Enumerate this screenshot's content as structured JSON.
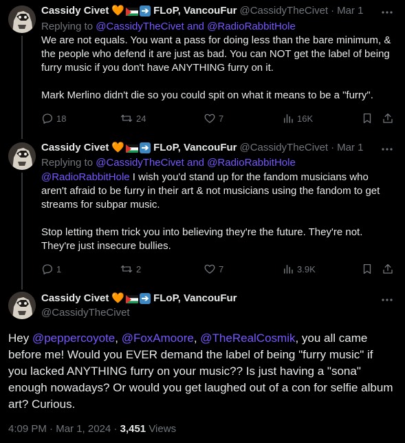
{
  "tweets": [
    {
      "name": "Cassidy Civet",
      "emoji": "🧡",
      "location": "FLoP, VancouFur",
      "handle": "@CassidyTheCivet",
      "dot": "·",
      "date": "Mar 1",
      "replying_prefix": "Replying to",
      "replying_to": "@CassidyTheCivet and @RadioRabbitHole",
      "paragraphs": [
        "We are not equals. You want a pass for doing less than the bare minimum, & the people who defend it are just as bad. You can NOT get the label of being furry music if you don't have ANYTHING furry on it.",
        "Mark Merlino didn't die so you could spit on what it means to be a \"furry\"."
      ],
      "stats": {
        "replies": "18",
        "reposts": "24",
        "likes": "7",
        "views": "16K"
      }
    },
    {
      "name": "Cassidy Civet",
      "emoji": "🧡",
      "location": "FLoP, VancouFur",
      "handle": "@CassidyTheCivet",
      "dot": "·",
      "date": "Mar 1",
      "replying_prefix": "Replying to",
      "replying_to": "@CassidyTheCivet and @RadioRabbitHole",
      "body_mention": "@RadioRabbitHole",
      "paragraph_1_rest": " I wish you'd stand up for the fandom musicians who aren't afraid to be furry in their art & not musicians using the fandom to get streams for subpar music.",
      "paragraph_2": "Stop letting them trick you into believing they're the future. They're not. They're just insecure bullies.",
      "stats": {
        "replies": "1",
        "reposts": "2",
        "likes": "7",
        "views": "3.9K"
      }
    }
  ],
  "main_tweet": {
    "name": "Cassidy Civet",
    "emoji": "🧡",
    "location": "FLoP, VancouFur",
    "handle": "@CassidyTheCivet",
    "body": {
      "t1": "Hey ",
      "m1": "@peppercoyote",
      "t2": ", ",
      "m2": "@FoxAmoore",
      "t3": ", ",
      "m3": "@TheRealCosmik",
      "t4": ", you all came before me! Would you EVER demand the label of being \"furry music\" if you lacked ANYTHING furry on your music?? Is just having a \"sona\" enough nowadays? Or would you get laughed out of a con for selfie album art? Curious."
    },
    "time": "4:09 PM",
    "dot": "·",
    "date": "Mar 1, 2024",
    "views_count": "3,451",
    "views_label": "Views"
  },
  "icons": {
    "more": "more-icon",
    "reply": "reply-icon",
    "repost": "repost-icon",
    "like": "like-icon",
    "views": "views-icon",
    "bookmark": "bookmark-icon",
    "share": "share-icon",
    "flag": "palestine-flag-icon",
    "arrow": "right-arrow-icon"
  },
  "colors": {
    "background": "#000000",
    "text": "#e7e9ea",
    "muted": "#71767b",
    "mention": "#7856ff",
    "thread_line": "#333639"
  }
}
